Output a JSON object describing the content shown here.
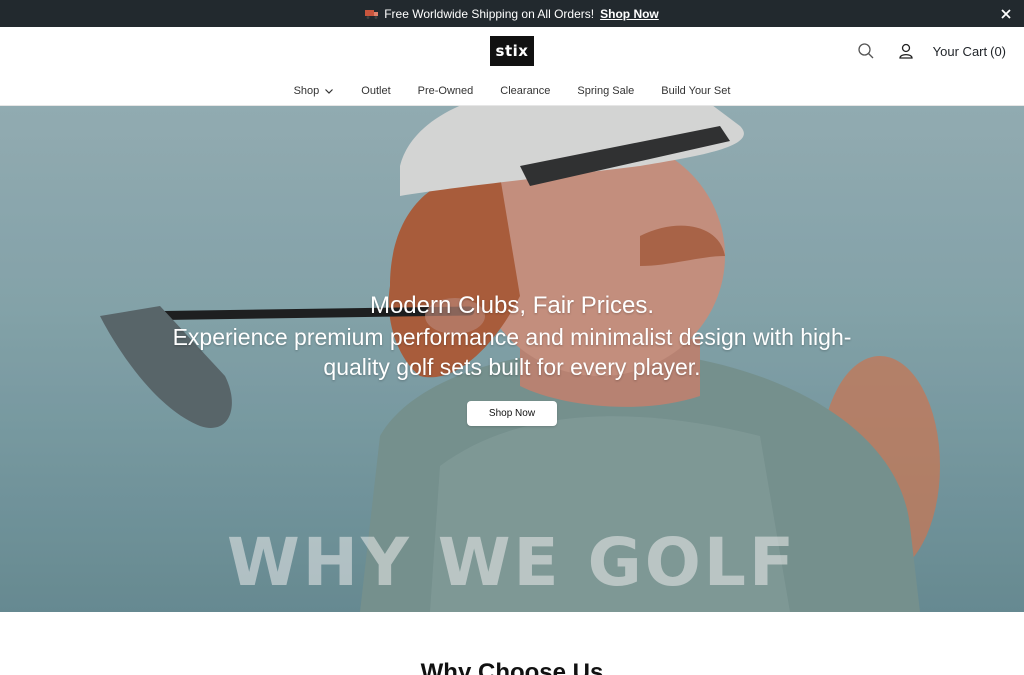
{
  "announcement": {
    "icon": "truck-icon",
    "message": "Free Worldwide Shipping on All Orders!",
    "link": "Shop Now"
  },
  "header": {
    "logo_text": "stix",
    "cart_label": "Your Cart",
    "cart_count": "(0)"
  },
  "nav": {
    "items": [
      {
        "label": "Shop"
      },
      {
        "label": "Outlet"
      },
      {
        "label": "Pre-Owned"
      },
      {
        "label": "Clearance"
      },
      {
        "label": "Spring Sale"
      },
      {
        "label": "Build Your Set"
      }
    ]
  },
  "hero": {
    "title": "Modern Clubs, Fair Prices.",
    "subtitle_line1": "Experience premium performance and minimalist design with high-",
    "subtitle_line2": "quality golf sets built for every player.",
    "button": "Shop Now",
    "watermark": "WHY WE GOLF"
  },
  "section": {
    "heading": "Why Choose Us"
  },
  "colors": {
    "announcement_bg": "#22292e",
    "logo_bg": "#111111",
    "hero_sky": "#8fb0b6"
  }
}
